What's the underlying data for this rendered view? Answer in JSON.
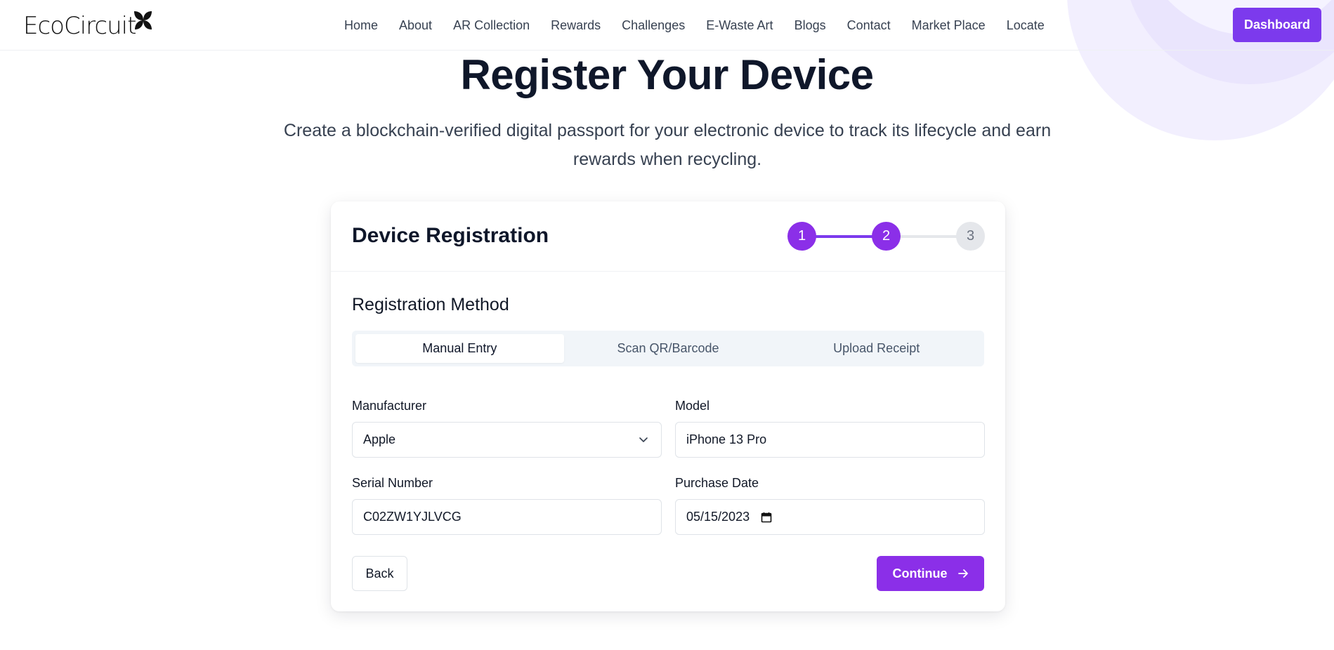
{
  "brand": {
    "name": "EcoCircuit",
    "accent": "#7c3aed"
  },
  "nav": {
    "links": [
      "Home",
      "About",
      "AR Collection",
      "Rewards",
      "Challenges",
      "E-Waste Art",
      "Blogs",
      "Contact",
      "Market Place",
      "Locate"
    ],
    "dashboard_label": "Dashboard"
  },
  "hero": {
    "title": "Register Your Device",
    "subtitle": "Create a blockchain-verified digital passport for your electronic device to track its lifecycle and earn rewards when recycling."
  },
  "card": {
    "title": "Device Registration",
    "steps": [
      "1",
      "2",
      "3"
    ],
    "current_step": 2,
    "section_label": "Registration Method",
    "tabs": [
      "Manual Entry",
      "Scan QR/Barcode",
      "Upload Receipt"
    ],
    "active_tab": "Manual Entry",
    "fields": {
      "manufacturer": {
        "label": "Manufacturer",
        "value": "Apple"
      },
      "model": {
        "label": "Model",
        "value": "iPhone 13 Pro"
      },
      "serial": {
        "label": "Serial Number",
        "value": "C02ZW1YJLVCG"
      },
      "purchase_date": {
        "label": "Purchase Date",
        "value": "05/15/2023"
      }
    },
    "back_label": "Back",
    "continue_label": "Continue"
  }
}
